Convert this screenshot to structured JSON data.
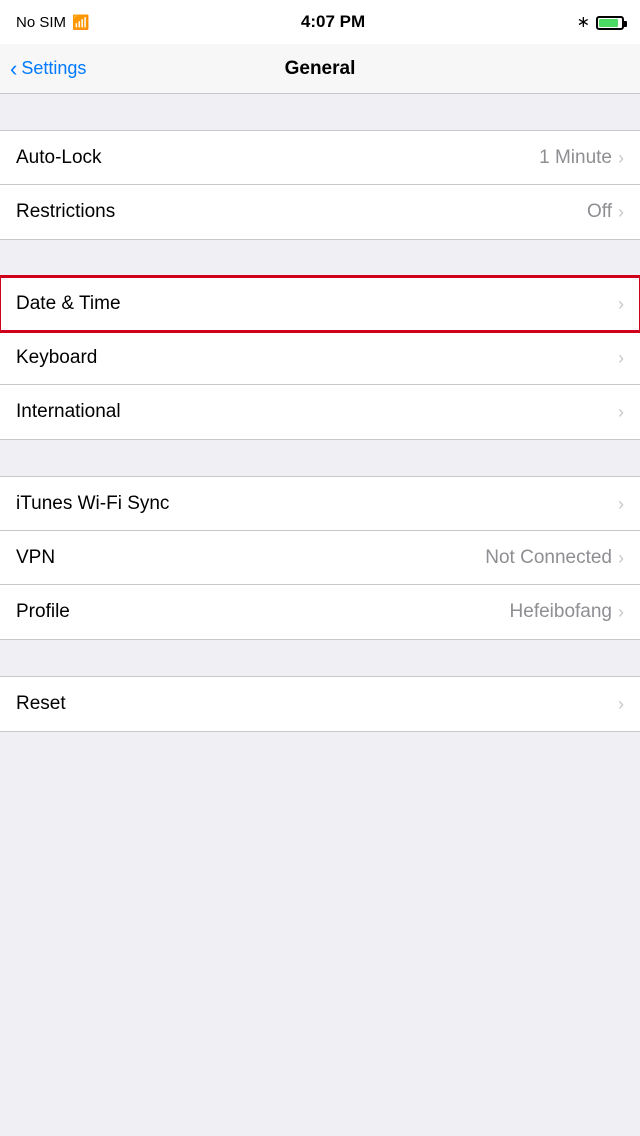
{
  "statusBar": {
    "carrier": "No SIM",
    "time": "4:07 PM",
    "bluetoothIcon": "bluetooth-icon",
    "batteryIcon": "battery-icon"
  },
  "navBar": {
    "backLabel": "Settings",
    "title": "General"
  },
  "groups": [
    {
      "id": "group1",
      "rows": [
        {
          "id": "auto-lock",
          "label": "Auto-Lock",
          "value": "1 Minute",
          "hasChevron": true
        },
        {
          "id": "restrictions",
          "label": "Restrictions",
          "value": "Off",
          "hasChevron": true
        }
      ]
    },
    {
      "id": "group2",
      "rows": [
        {
          "id": "date-time",
          "label": "Date & Time",
          "value": "",
          "hasChevron": true,
          "highlighted": true
        },
        {
          "id": "keyboard",
          "label": "Keyboard",
          "value": "",
          "hasChevron": true
        },
        {
          "id": "international",
          "label": "International",
          "value": "",
          "hasChevron": true
        }
      ]
    },
    {
      "id": "group3",
      "rows": [
        {
          "id": "itunes-wifi-sync",
          "label": "iTunes Wi-Fi Sync",
          "value": "",
          "hasChevron": true
        },
        {
          "id": "vpn",
          "label": "VPN",
          "value": "Not Connected",
          "hasChevron": true
        },
        {
          "id": "profile",
          "label": "Profile",
          "value": "Hefeibofang",
          "hasChevron": true
        }
      ]
    },
    {
      "id": "group4",
      "rows": [
        {
          "id": "reset",
          "label": "Reset",
          "value": "",
          "hasChevron": true
        }
      ]
    }
  ],
  "chevronChar": "›",
  "colors": {
    "accent": "#007aff",
    "highlight": "#d0021b",
    "valueFg": "#8e8e93",
    "chevronFg": "#c7c7cc"
  }
}
